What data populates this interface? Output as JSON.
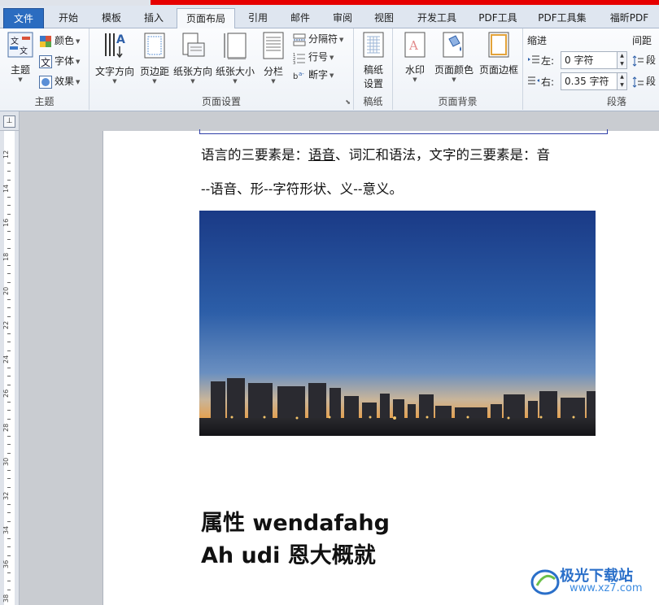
{
  "tabs": [
    "文件",
    "开始",
    "模板",
    "插入",
    "页面布局",
    "引用",
    "邮件",
    "审阅",
    "视图",
    "开发工具",
    "PDF工具",
    "PDF工具集",
    "福昕PDF"
  ],
  "active_tab": "页面布局",
  "ribbon": {
    "theme_group": {
      "label": "主题",
      "theme_button": "主题",
      "colors": "颜色",
      "fonts": "字体",
      "effects": "效果"
    },
    "page_setup_group": {
      "label": "页面设置",
      "text_direction": "文字方向",
      "margins": "页边距",
      "orientation": "纸张方向",
      "size": "纸张大小",
      "columns": "分栏",
      "breaks": "分隔符",
      "line_numbers": "行号",
      "hyphenation": "断字"
    },
    "draft_paper_group": {
      "label": "稿纸",
      "draft_settings": "稿纸\n设置",
      "draft_line1": "稿纸",
      "draft_line2": "设置"
    },
    "page_background_group": {
      "label": "页面背景",
      "watermark": "水印",
      "page_color": "页面颜色",
      "page_borders": "页面边框"
    },
    "paragraph_group": {
      "label": "段落",
      "indent_title": "缩进",
      "indent_left_label": "左:",
      "indent_left_value": "0 字符",
      "indent_right_label": "右:",
      "indent_right_value": "0.35 字符",
      "spacing_title": "间距",
      "spacing_before_label": "段",
      "spacing_after_label": "段"
    }
  },
  "ruler": {
    "numbers": [
      "12",
      "14",
      "16",
      "18",
      "20",
      "22",
      "24",
      "26",
      "28",
      "30",
      "32",
      "34",
      "36",
      "38"
    ]
  },
  "document": {
    "para1_before": "语言的三要素是：",
    "para1_underlined": "语音",
    "para1_after": "、词汇和语法，文字的三要素是：音",
    "para2": "--语音、形--字符形状、义--意义。",
    "image_alt": "city skyline at dusk",
    "big_line1": " 属性 wendafahg",
    "big_line2": "Ah udi 恩大概就"
  },
  "watermark": {
    "text": "极光下载站",
    "url": "www.xz7.com"
  },
  "colors": {
    "file_tab": "#2b6cc0",
    "accent_red": "#e60000",
    "sky_top": "#1f3f8a",
    "sky_bottom": "#e8a04c"
  }
}
